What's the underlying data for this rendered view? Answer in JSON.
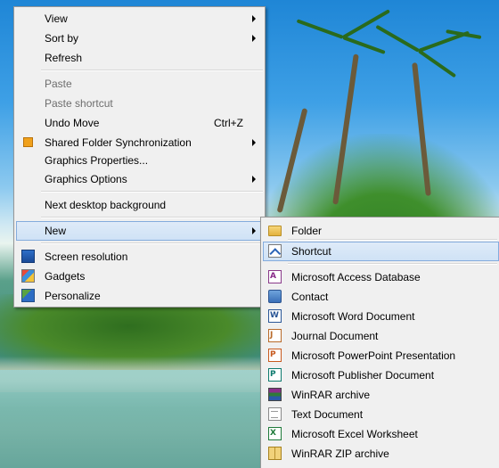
{
  "main_menu": {
    "items": [
      {
        "label": "View",
        "has_submenu": true
      },
      {
        "label": "Sort by",
        "has_submenu": true
      },
      {
        "label": "Refresh"
      },
      {
        "label": "Paste",
        "disabled": true
      },
      {
        "label": "Paste shortcut",
        "disabled": true
      },
      {
        "label": "Undo Move",
        "shortcut": "Ctrl+Z"
      },
      {
        "label": "Shared Folder Synchronization",
        "has_submenu": true,
        "icon": "sync-folder-icon"
      },
      {
        "label": "Graphics Properties..."
      },
      {
        "label": "Graphics Options",
        "has_submenu": true
      },
      {
        "label": "Next desktop background"
      },
      {
        "label": "New",
        "has_submenu": true,
        "highlighted": true
      },
      {
        "label": "Screen resolution",
        "icon": "screen-resolution-icon"
      },
      {
        "label": "Gadgets",
        "icon": "gadgets-icon"
      },
      {
        "label": "Personalize",
        "icon": "personalize-icon"
      }
    ]
  },
  "new_submenu": {
    "items": [
      {
        "label": "Folder",
        "icon": "folder-icon"
      },
      {
        "label": "Shortcut",
        "icon": "shortcut-icon",
        "highlighted": true
      },
      {
        "label": "Microsoft Access Database",
        "icon": "access-icon"
      },
      {
        "label": "Contact",
        "icon": "contact-icon"
      },
      {
        "label": "Microsoft Word Document",
        "icon": "word-icon"
      },
      {
        "label": "Journal Document",
        "icon": "journal-icon"
      },
      {
        "label": "Microsoft PowerPoint Presentation",
        "icon": "powerpoint-icon"
      },
      {
        "label": "Microsoft Publisher Document",
        "icon": "publisher-icon"
      },
      {
        "label": "WinRAR archive",
        "icon": "winrar-icon"
      },
      {
        "label": "Text Document",
        "icon": "text-document-icon"
      },
      {
        "label": "Microsoft Excel Worksheet",
        "icon": "excel-icon"
      },
      {
        "label": "WinRAR ZIP archive",
        "icon": "winrar-zip-icon"
      }
    ]
  },
  "colors": {
    "menu_background": "#f0f0f0",
    "highlight": "#cfe2f6",
    "highlight_border": "#84acdd",
    "disabled_text": "#6d6d6d"
  }
}
